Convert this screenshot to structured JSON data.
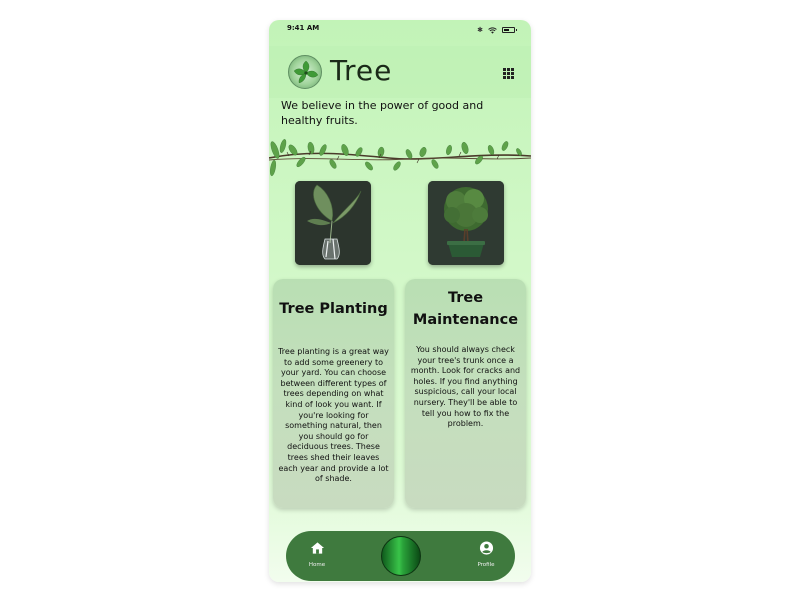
{
  "status_bar": {
    "time": "9:41 AM"
  },
  "header": {
    "title": "Tree"
  },
  "tagline": "We believe in the power of good and healthy fruits.",
  "cards": [
    {
      "title": "Tree Planting",
      "body": "Tree planting is a great way to add some greenery to your yard. You can choose between different types of trees depending on what kind of look you want. If you're looking for something natural, then you should go for deciduous trees. These trees shed their leaves each year and provide a lot of shade."
    },
    {
      "title": "Tree Maintenance",
      "body": "You should always check your tree's trunk once a month. Look for cracks and holes. If you find anything suspicious, call your local nursery. They'll be able to tell you how to fix the problem."
    }
  ],
  "nav": {
    "home_label": "Home",
    "profile_label": "Profile"
  },
  "colors": {
    "nav_bg": "#3f7a3e",
    "background": "#c8f5bd",
    "card": "#c4dfbd"
  },
  "icons": [
    "leaf-logo-icon",
    "grid-menu-icon",
    "bluetooth-icon",
    "wifi-icon",
    "battery-icon",
    "home-icon",
    "profile-icon"
  ]
}
